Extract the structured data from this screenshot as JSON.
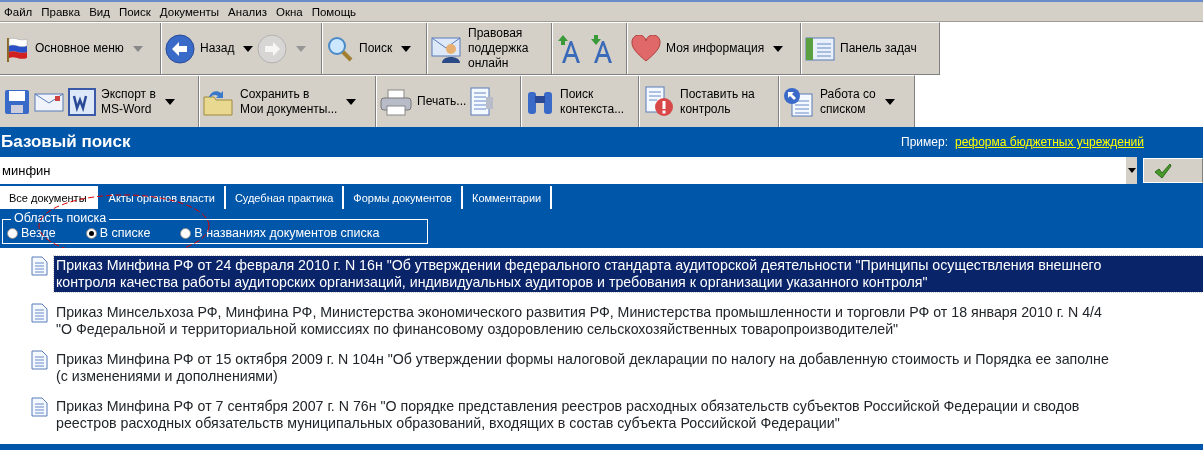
{
  "menu_bar": [
    "Файл",
    "Правка",
    "Вид",
    "Поиск",
    "Документы",
    "Анализ",
    "Окна",
    "Помощь"
  ],
  "toolbar_1": [
    [
      {
        "kind": "flag",
        "label": "Основное меню",
        "dropdown": true,
        "disabled": false
      }
    ],
    [
      {
        "kind": "back",
        "label": "Назад",
        "dropdown": true,
        "disabled": false
      },
      {
        "kind": "forward",
        "dropdown": true,
        "disabled": true
      }
    ],
    [
      {
        "kind": "search",
        "label": "Поиск",
        "dropdown": true,
        "disabled": false
      }
    ],
    [
      {
        "kind": "support",
        "label": "Правовая\nподдержка\nонлайн",
        "dropdown": false,
        "disabled": false
      }
    ],
    [
      {
        "kind": "font-up",
        "dropdown": false,
        "disabled": false
      },
      {
        "kind": "font-down",
        "dropdown": false,
        "disabled": false
      }
    ],
    [
      {
        "kind": "heart",
        "label": "Моя информация",
        "dropdown": true,
        "disabled": false
      }
    ],
    [
      {
        "kind": "panel",
        "label": "Панель задач",
        "dropdown": false,
        "disabled": false
      }
    ]
  ],
  "toolbar_2": [
    [
      {
        "kind": "disk",
        "dropdown": false,
        "disabled": false
      },
      {
        "kind": "mail",
        "dropdown": false,
        "disabled": false
      },
      {
        "kind": "word",
        "label": "Экспорт в\nMS-Word",
        "dropdown": true,
        "disabled": false
      }
    ],
    [
      {
        "kind": "folder",
        "label": "Сохранить в\nМои документы...",
        "dropdown": true,
        "disabled": false
      }
    ],
    [
      {
        "kind": "printer",
        "label": "Печать...",
        "dropdown": false,
        "disabled": false
      },
      {
        "kind": "preview",
        "dropdown": false,
        "disabled": false
      }
    ],
    [
      {
        "kind": "binoculars",
        "label": "Поиск\nконтекста...",
        "dropdown": false,
        "disabled": false
      }
    ],
    [
      {
        "kind": "alert-doc",
        "label": "Поставить на\nконтроль",
        "dropdown": false,
        "disabled": false
      }
    ],
    [
      {
        "kind": "list-doc",
        "label": "Работа со\nсписком",
        "dropdown": true,
        "disabled": false
      }
    ]
  ],
  "search_panel": {
    "title": "Базовый поиск",
    "example_label": "Пример:",
    "example_link": "реформа бюджетных учреждений",
    "query": "минфин",
    "tabs": [
      {
        "label": "Все документы",
        "selected": true
      },
      {
        "label": "Акты органов власти",
        "selected": false
      },
      {
        "label": "Судебная практика",
        "selected": false
      },
      {
        "label": "Формы документов",
        "selected": false
      },
      {
        "label": "Комментарии",
        "selected": false
      }
    ],
    "scope": {
      "title": "Область поиска",
      "options": [
        {
          "label": "Везде",
          "selected": false
        },
        {
          "label": "В списке",
          "selected": true
        },
        {
          "label": "В названиях документов списка",
          "selected": false
        }
      ]
    }
  },
  "documents": [
    {
      "selected": true,
      "lines": [
        "Приказ Минфина РФ от 24 февраля 2010 г. N 16н \"Об утверждении федерального стандарта аудиторской деятельности \"Принципы осуществления внешнего",
        "контроля качества работы аудиторских организаций, индивидуальных аудиторов и требования к организации указанного контроля\""
      ]
    },
    {
      "selected": false,
      "lines": [
        "Приказ Минсельхоза РФ, Минфина РФ, Министерства экономического развития РФ, Министерства промышленности и торговли РФ от 18 января 2010 г. N 4/4",
        "\"О Федеральной и территориальной комиссиях по финансовому оздоровлению сельскохозяйственных товаропроизводителей\""
      ]
    },
    {
      "selected": false,
      "lines": [
        "Приказ Минфина РФ от 15 октября 2009 г. N 104н \"Об утверждении формы налоговой декларации по налогу на добавленную стоимость и Порядка ее заполне",
        "(с изменениями и дополнениями)"
      ]
    },
    {
      "selected": false,
      "lines": [
        "Приказ Минфина РФ от 7 сентября 2007 г. N 76н \"О порядке представления реестров расходных обязательств субъектов Российской Федерации и сводов",
        "реестров расходных обязательств муниципальных образований, входящих в состав субъекта Российской Федерации\""
      ]
    }
  ]
}
